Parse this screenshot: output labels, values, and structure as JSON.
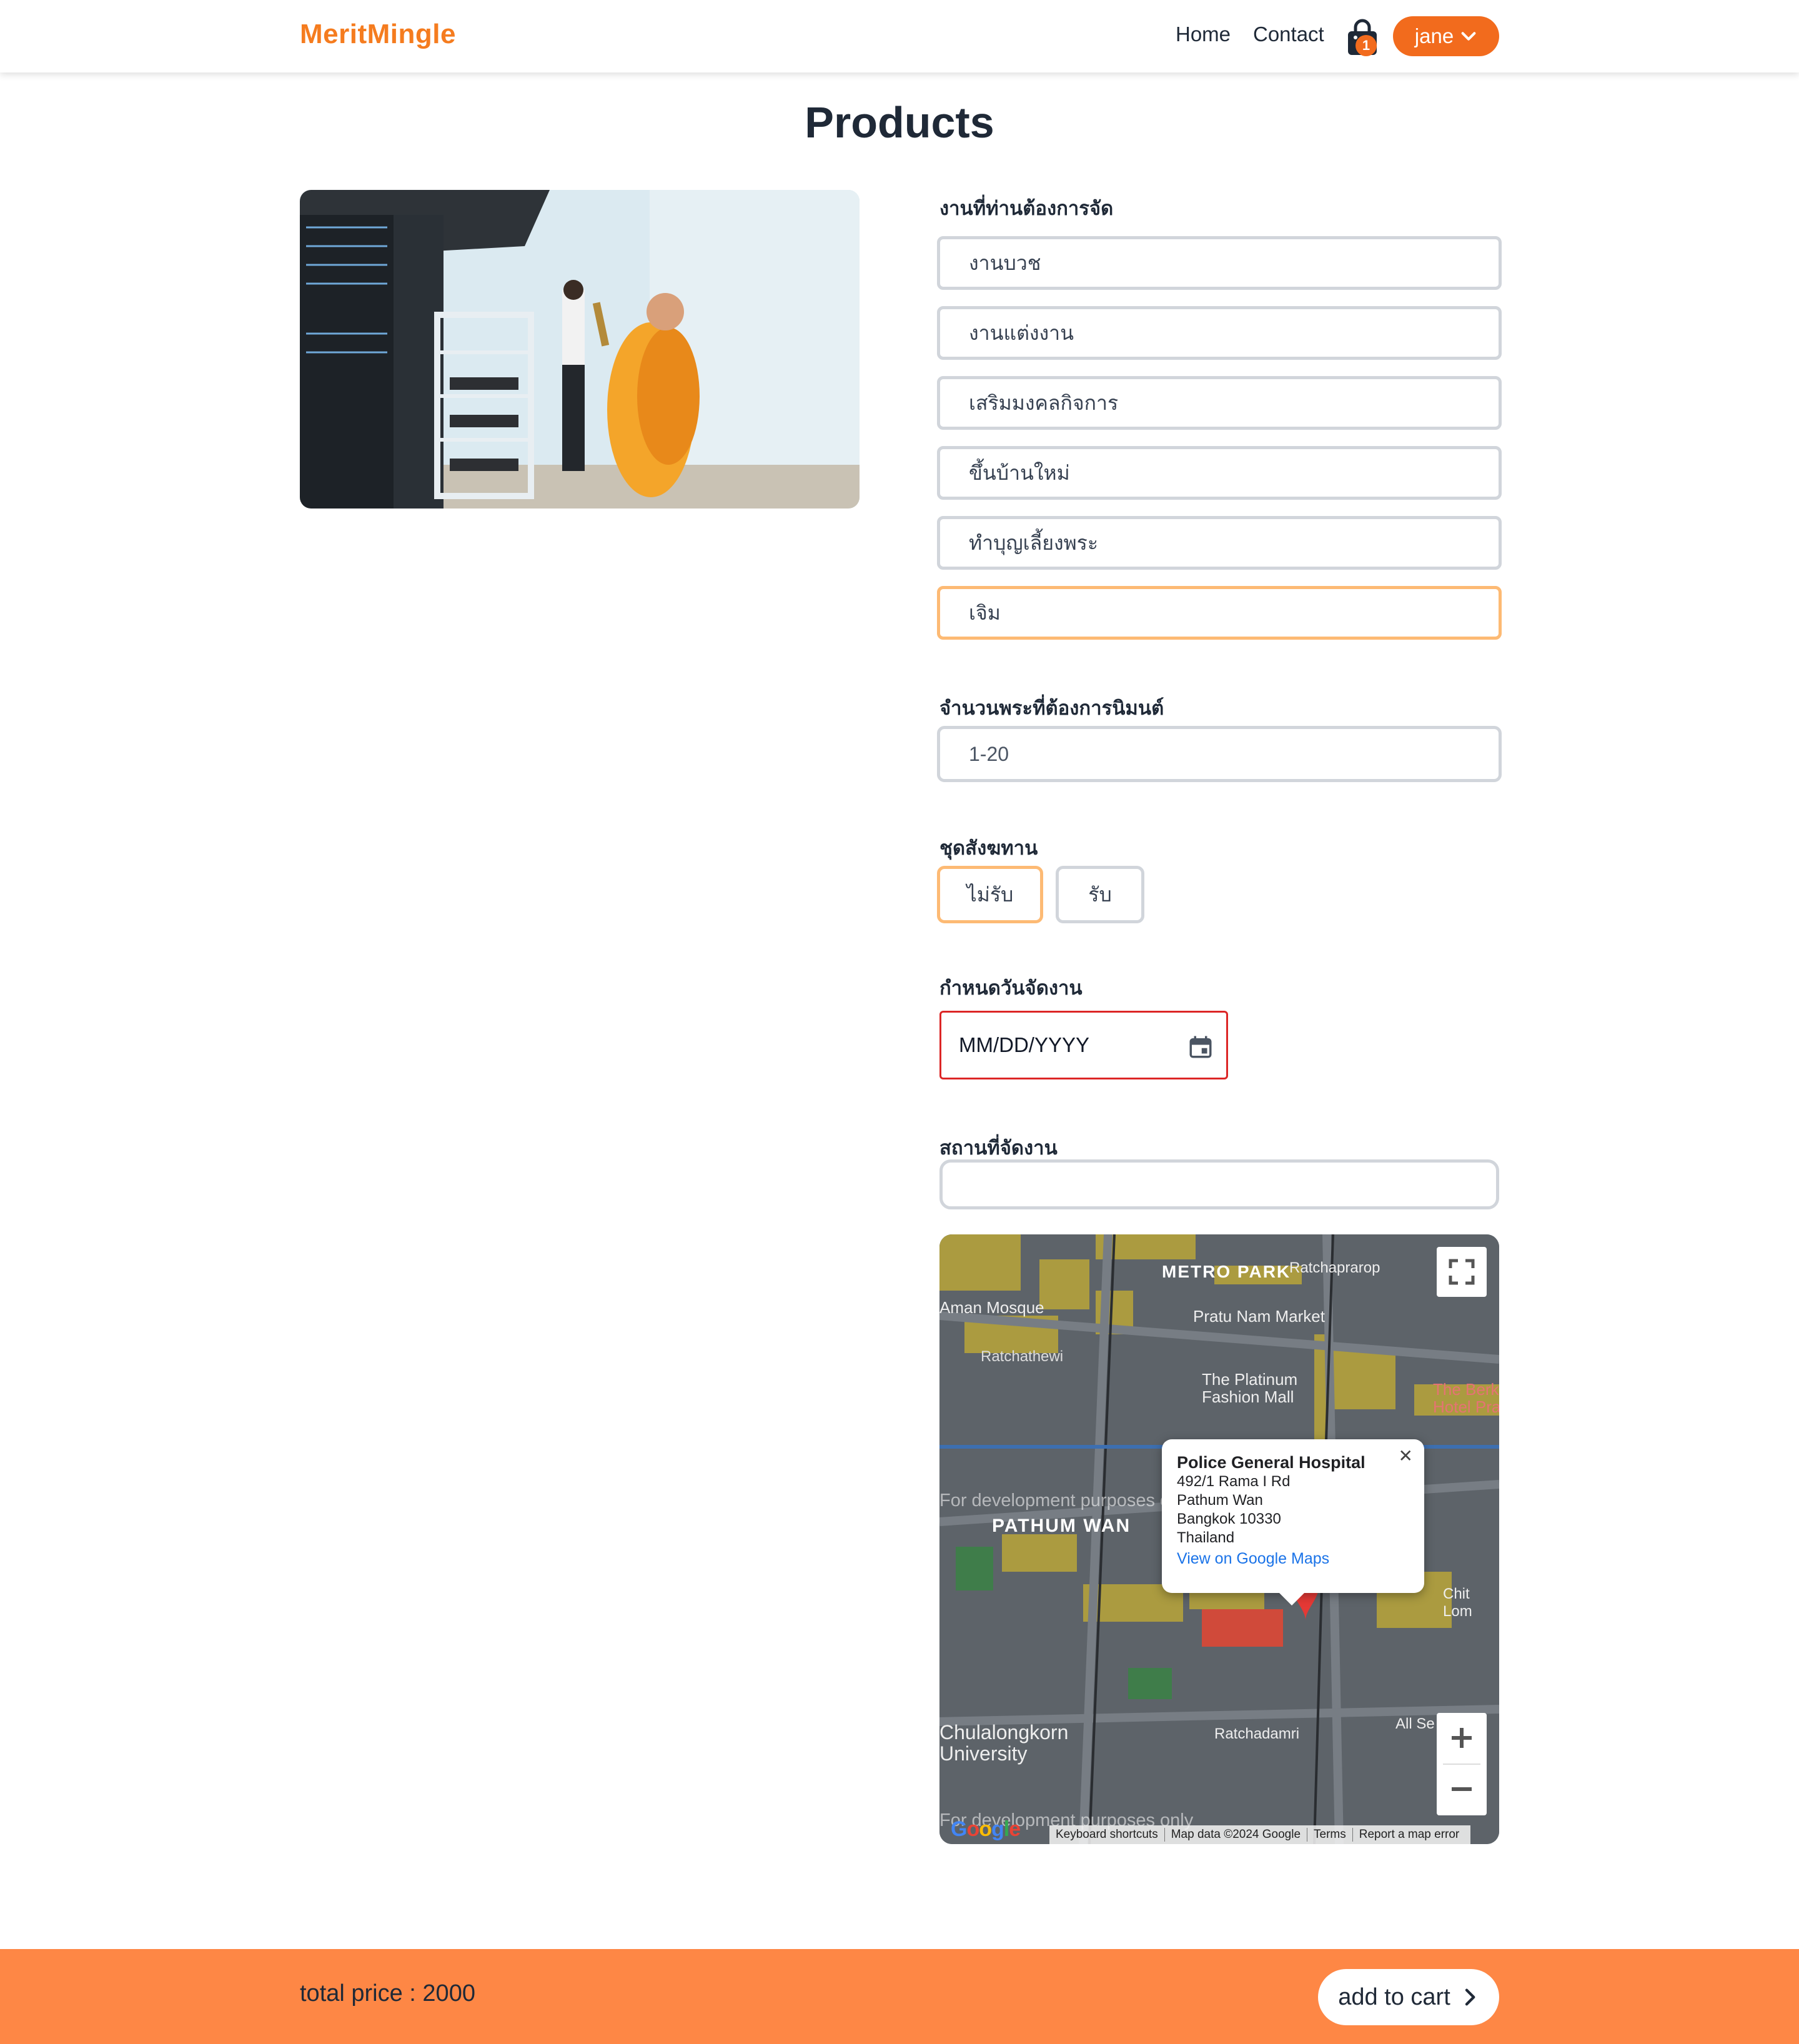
{
  "nav": {
    "logo": "MeritMingle",
    "links": [
      "Home",
      "Contact"
    ],
    "cart_count": "1",
    "user": "jane"
  },
  "page_title": "Products",
  "form": {
    "event_label": "งานที่ท่านต้องการจัด",
    "event_options": [
      "งานบวช",
      "งานแต่งงาน",
      "เสริมมงคลกิจการ",
      "ขึ้นบ้านใหม่",
      "ทำบุญเลี้ยงพระ",
      "เจิม"
    ],
    "selected_event": "เจิม",
    "monks_label": "จำนวนพระที่ต้องการนิมนต์",
    "monks_placeholder": "1-20",
    "offering_label": "ชุดสังฆทาน",
    "offering_options": [
      "ไม่รับ",
      "รับ"
    ],
    "selected_offering": "ไม่รับ",
    "date_label": "กำหนดวันจัดงาน",
    "date_placeholder": "MM/DD/YYYY",
    "location_label": "สถานที่จัดงาน",
    "location_value": ""
  },
  "map": {
    "popup": {
      "name": "Police General Hospital",
      "address_lines": [
        "492/1 Rama I Rd",
        "Pathum Wan",
        "Bangkok 10330",
        "Thailand"
      ],
      "link": "View on Google Maps"
    },
    "labels": [
      "METRO PARK",
      "Ratchaprarop",
      "Pratu Nam Market",
      "Aman Mosque",
      "Ratchathewi",
      "The Platinum Fashion Mall",
      "The Berk Hotel Pra",
      "PATHUM WAN",
      "Chit Lom",
      "Chulalongkorn University",
      "Ratchadamri",
      "All Se"
    ],
    "watermark": "For development purposes only",
    "attribution": [
      "Keyboard shortcuts",
      "Map data ©2024 Google",
      "Terms",
      "Report a map error"
    ],
    "google_logo": "Google"
  },
  "footer": {
    "total_label": "total price : 2000",
    "add_button": "add to cart"
  },
  "colors": {
    "brand": "#f57c1f",
    "accent": "#f26b1d",
    "bottom_bar": "#fe8745",
    "selected_border": "#fdba74",
    "error_border": "#dc2626"
  }
}
